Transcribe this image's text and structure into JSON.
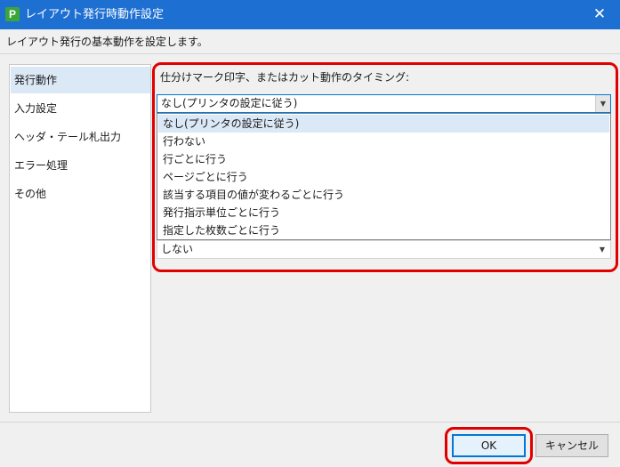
{
  "window": {
    "title": "レイアウト発行時動作設定",
    "app_icon_letter": "P",
    "close_glyph": "✕"
  },
  "description": "レイアウト発行の基本動作を設定します。",
  "sidebar": {
    "items": [
      {
        "label": "発行動作",
        "selected": true
      },
      {
        "label": "入力設定",
        "selected": false
      },
      {
        "label": "ヘッダ・テール札出力",
        "selected": false
      },
      {
        "label": "エラー処理",
        "selected": false
      },
      {
        "label": "その他",
        "selected": false
      }
    ]
  },
  "settings": {
    "timing_label": "仕分けマーク印字、またはカット動作のタイミング:",
    "timing_value": "なし(プリンタの設定に従う)",
    "timing_options": [
      "なし(プリンタの設定に従う)",
      "行わない",
      "行ごとに行う",
      "ページごとに行う",
      "該当する項目の値が変わるごとに行う",
      "発行指示単位ごとに行う",
      "指定した枚数ごとに行う"
    ],
    "second_value": "しない"
  },
  "footer": {
    "ok_label": "OK",
    "cancel_label": "キャンセル"
  },
  "colors": {
    "titlebar": "#1d6fd1",
    "highlight": "#e10000",
    "selection": "#dbe8f5"
  },
  "icons": {
    "app": "app-logo-icon",
    "close": "close-icon",
    "dropdown": "chevron-down-icon"
  }
}
